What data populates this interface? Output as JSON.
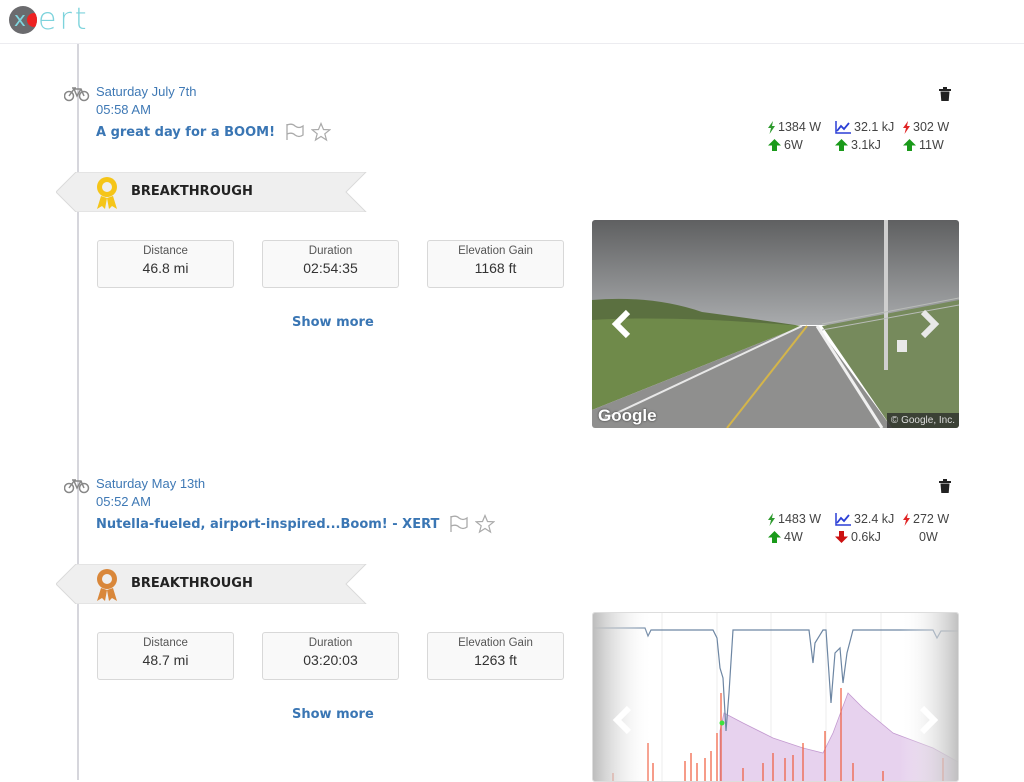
{
  "app": {
    "logo_text": "ert",
    "logo_letter": "x"
  },
  "activities": [
    {
      "date": "Saturday July 7th",
      "time": "05:58 AM",
      "title": "A great day for a BOOM!",
      "metrics": {
        "peak_power": "1384 W",
        "energy": "32.1 kJ",
        "threshold_power": "302 W",
        "change_peak": "6W",
        "change_energy": "3.1kJ",
        "change_threshold": "11W",
        "change_peak_dir": "up",
        "change_energy_dir": "up",
        "change_threshold_dir": "up"
      },
      "badge": {
        "label": "BREAKTHROUGH",
        "medal_color": "#f5c518"
      },
      "stats": [
        {
          "label": "Distance",
          "value": "46.8 mi"
        },
        {
          "label": "Duration",
          "value": "02:54:35"
        },
        {
          "label": "Elevation Gain",
          "value": "1168 ft"
        }
      ],
      "show_more_label": "Show more",
      "media": {
        "type": "street-view",
        "google_logo": "Google",
        "copyright": "© Google, Inc."
      }
    },
    {
      "date": "Saturday May 13th",
      "time": "05:52 AM",
      "title": "Nutella-fueled, airport-inspired...Boom! - XERT",
      "metrics": {
        "peak_power": "1483 W",
        "energy": "32.4 kJ",
        "threshold_power": "272 W",
        "change_peak": "4W",
        "change_energy": "0.6kJ",
        "change_threshold": "0W",
        "change_peak_dir": "up",
        "change_energy_dir": "down",
        "change_threshold_dir": "none"
      },
      "badge": {
        "label": "BREAKTHROUGH",
        "medal_color": "#d9873a"
      },
      "stats": [
        {
          "label": "Distance",
          "value": "48.7 mi"
        },
        {
          "label": "Duration",
          "value": "03:20:03"
        },
        {
          "label": "Elevation Gain",
          "value": "1263 ft"
        }
      ],
      "show_more_label": "Show more",
      "media": {
        "type": "power-chart"
      }
    }
  ],
  "colors": {
    "link_blue": "#3a76b4",
    "logo_teal": "#7dd3dc",
    "up_green": "#1a9a1a",
    "down_red": "#cc1111",
    "peak_green": "#2e9a2e",
    "threshold_red": "#e02525",
    "energy_blue": "#2b3fd6"
  }
}
